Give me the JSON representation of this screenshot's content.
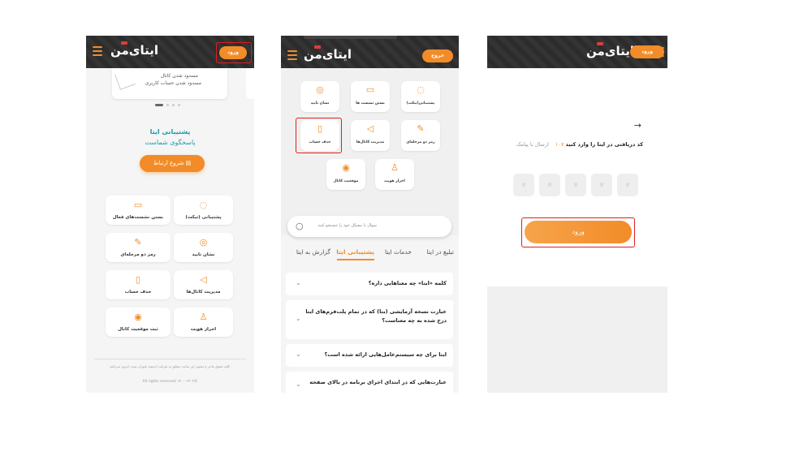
{
  "brand": {
    "logo_text": "ایتای‌من",
    "accent": "#f28c28",
    "header_bg": "#2c2c2c",
    "teal": "#1a9aa8",
    "highlight": "#e01f1f"
  },
  "screen1": {
    "login_label": "ورود",
    "carousel": {
      "line1": "مسدود شدن کانال",
      "line2": "مسدود شدن حساب کاربری"
    },
    "support_title": "پشتیبانی ایتا",
    "support_subtitle": "پاسخگوی شماست",
    "start_chat": "شروع ارتباط",
    "tiles": [
      {
        "label": "پشتیبانی (تیکت)",
        "icon": "chat-bubble-icon"
      },
      {
        "label": "بستن نشست‌های فعال",
        "icon": "devices-icon"
      },
      {
        "label": "نشان تایید",
        "icon": "verified-badge-icon"
      },
      {
        "label": "رمز دو مرحله‌ای",
        "icon": "edit-lock-icon"
      },
      {
        "label": "مدیریت کانال‌ها",
        "icon": "megaphone-icon"
      },
      {
        "label": "حذف حساب",
        "icon": "trash-icon"
      },
      {
        "label": "احراز هویت",
        "icon": "user-check-icon"
      },
      {
        "label": "ثبت موقعیت کانال",
        "icon": "location-pin-icon"
      }
    ],
    "footer_rights": "کلیه حقوق مادی و معنوی این سایت متعلق به شرکت اندیشه پایوران تمدن امروز می‌باشد.",
    "footer_copy": "All rights reserved ۱۴۰۰-۱۴۰۳©"
  },
  "screen2": {
    "logout_label": "خروج",
    "tiles": [
      {
        "label": "پشتیبانی(تیکت)",
        "icon": "chat-bubble-icon"
      },
      {
        "label": "بستن نشست ها",
        "icon": "devices-icon"
      },
      {
        "label": "نشان تایید",
        "icon": "verified-badge-icon"
      },
      {
        "label": "رمز دو مرحله‌ای",
        "icon": "edit-lock-icon"
      },
      {
        "label": "مدیریت کانال‌ها",
        "icon": "megaphone-icon"
      },
      {
        "label": "حذف حساب",
        "icon": "trash-icon"
      },
      {
        "label": "احراز هویت",
        "icon": "user-check-icon"
      },
      {
        "label": "موقعیت کانال",
        "icon": "location-pin-icon"
      }
    ],
    "search_placeholder": "سوال یا مشکل خود را جستجو کنید",
    "tabs": [
      "گزارش به ایتا",
      "پشتیبانی ایتا",
      "خدمات ایتا",
      "تبلیغ در ایتا"
    ],
    "active_tab_index": 1,
    "faqs": [
      "کلمه «ایتا» چه معناهایی داره؟",
      "عبارت نسخه آزمایشی (بتا) که در تمام پلت‌فرم‌های ایتا درج شده به چه معناست؟",
      "ایتا برای چه سیستم‌عامل‌هایی ارائه شده است؟",
      "عبارت‌هایی که در ابتدای اجرای برنامه در بالای صفحه"
    ]
  },
  "screen3": {
    "login_label": "ورود",
    "back_arrow": "→",
    "code_prompt": "کد دریافتی در ایتا را وارد کنید",
    "countdown": "۱۰۷",
    "sms_link": "ارسال با پیامک",
    "otp_count": 5,
    "submit_label": "ورود"
  }
}
